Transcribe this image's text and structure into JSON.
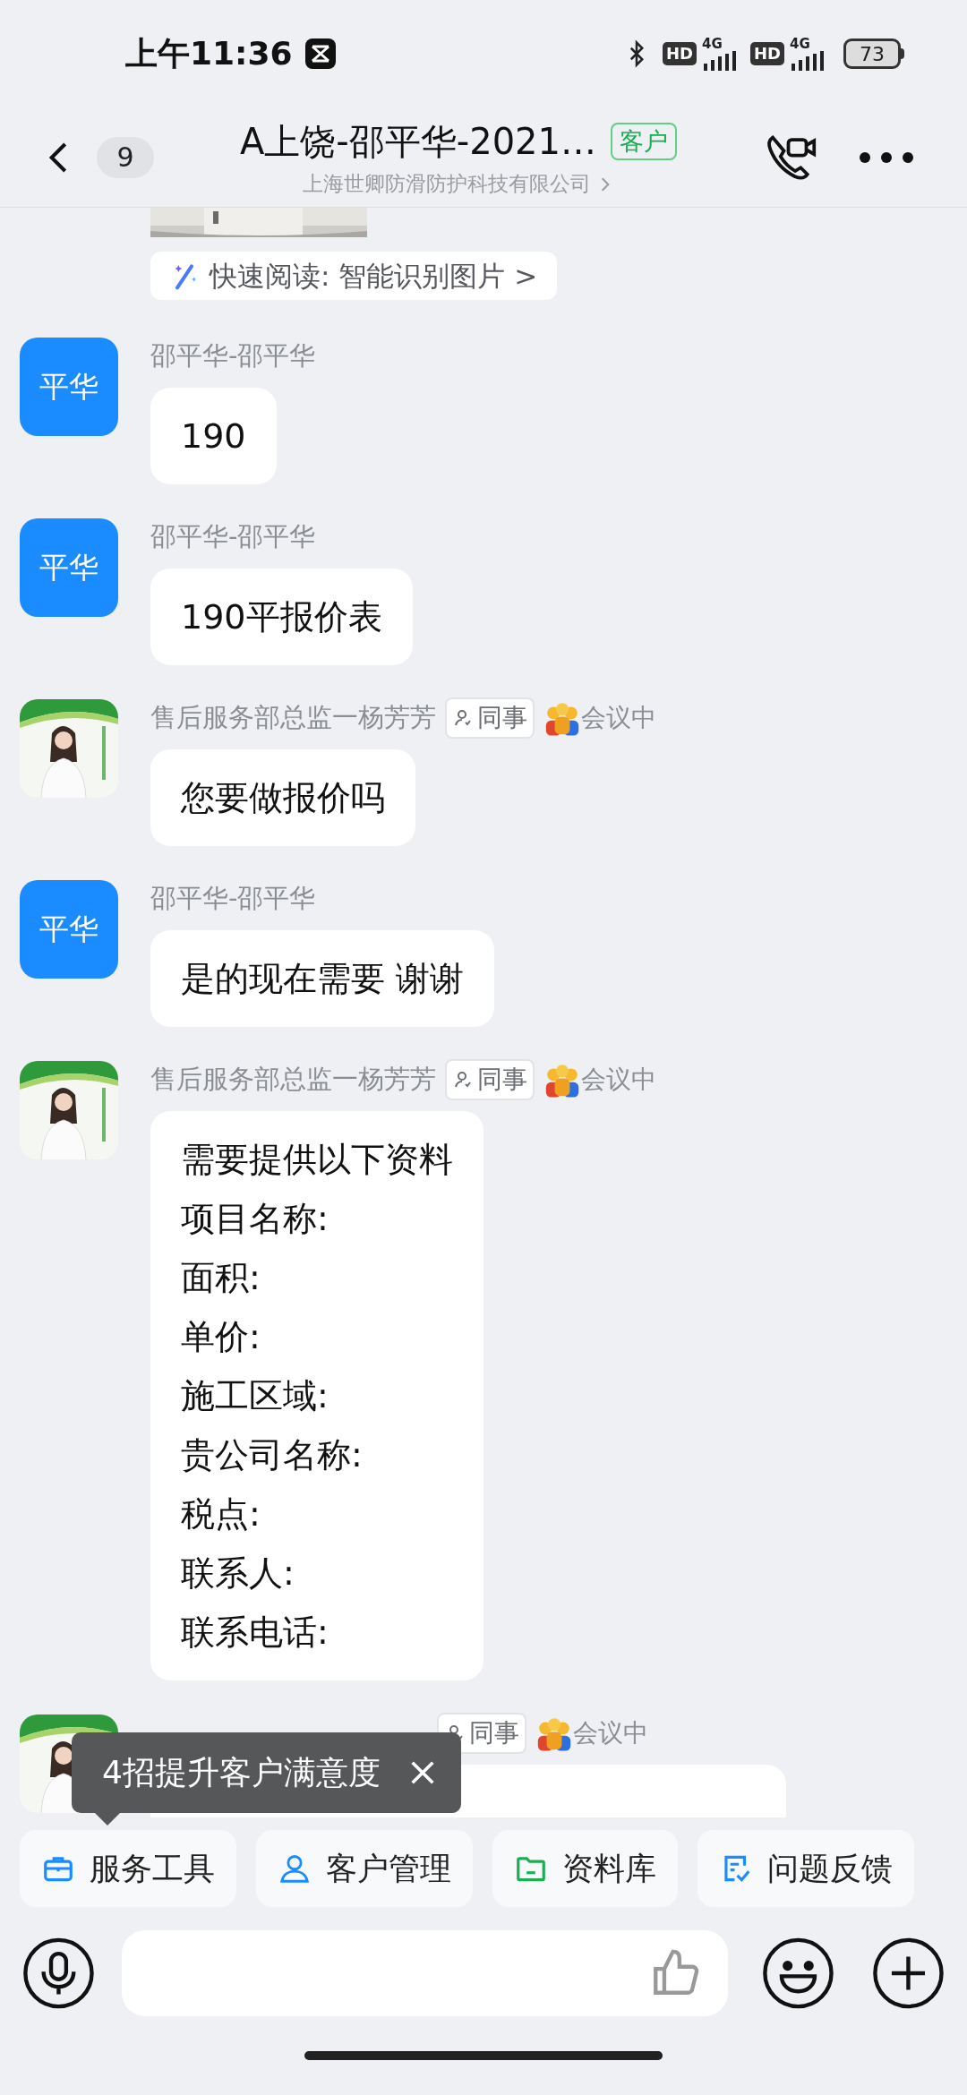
{
  "status_bar": {
    "time": "上午11:36",
    "signals": [
      {
        "badge": "HD",
        "network": "4G"
      },
      {
        "badge": "HD",
        "network": "4G"
      }
    ],
    "battery": "73"
  },
  "header": {
    "unread_count": "9",
    "title": "A上饶-邵平华-2021…",
    "tag": "客户",
    "subtitle": "上海世卿防滑防护科技有限公司"
  },
  "quick_read": "快速阅读: 智能识别图片 >",
  "messages": [
    {
      "avatar": {
        "kind": "text",
        "text": "平华"
      },
      "sender": "邵平华-邵平华",
      "lines": [
        "190"
      ]
    },
    {
      "avatar": {
        "kind": "text",
        "text": "平华"
      },
      "sender": "邵平华-邵平华",
      "lines": [
        "190平报价表"
      ]
    },
    {
      "avatar": {
        "kind": "picture"
      },
      "sender": "售后服务部总监一杨芳芳",
      "tag": "同事",
      "status": "会议中",
      "lines": [
        "您要做报价吗"
      ]
    },
    {
      "avatar": {
        "kind": "text",
        "text": "平华"
      },
      "sender": "邵平华-邵平华",
      "lines": [
        "是的现在需要 谢谢"
      ]
    },
    {
      "avatar": {
        "kind": "picture"
      },
      "sender": "售后服务部总监一杨芳芳",
      "tag": "同事",
      "status": "会议中",
      "lines": [
        "需要提供以下资料",
        "项目名称:",
        "面积:",
        "单价:",
        "施工区域:",
        "贵公司名称:",
        "税点:",
        "联系人:",
        "联系电话:"
      ]
    },
    {
      "avatar": {
        "kind": "picture"
      },
      "tag": "同事",
      "status": "会议中"
    }
  ],
  "tooltip": {
    "text": "4招提升客户满意度"
  },
  "toolbar": [
    {
      "kind": "briefcase",
      "label": "服务工具"
    },
    {
      "kind": "person",
      "label": "客户管理"
    },
    {
      "kind": "folder",
      "label": "资料库"
    },
    {
      "kind": "feedback",
      "label": "问题反馈"
    }
  ]
}
